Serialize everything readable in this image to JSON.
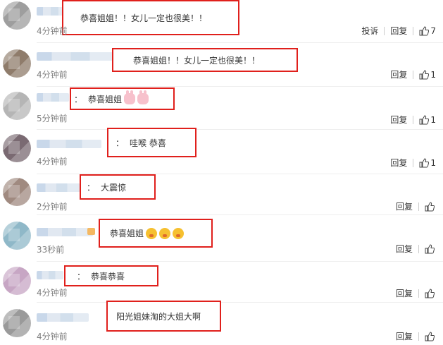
{
  "labels": {
    "report": "投诉",
    "reply": "回复",
    "colon": "："
  },
  "colors": {
    "highlight_border": "#e0201c",
    "username_blur": "#c9d8ea",
    "time_text": "#808080"
  },
  "comments": [
    {
      "text": "恭喜姐姐！！女儿一定也很美！！",
      "time": "4分钟前",
      "likes": "7",
      "show_report": true,
      "emojis": []
    },
    {
      "text": "恭喜姐姐！！女儿一定也很美！！",
      "time": "4分钟前",
      "likes": "1",
      "show_report": false,
      "emojis": []
    },
    {
      "text": "恭喜姐姐",
      "time": "5分钟前",
      "likes": "1",
      "show_report": false,
      "emojis": [
        "rabbit-emoji",
        "rabbit-emoji"
      ]
    },
    {
      "text": "哇喉 恭喜",
      "time": "4分钟前",
      "likes": "1",
      "show_report": false,
      "emojis": []
    },
    {
      "text": "大震惊",
      "time": "2分钟前",
      "likes": "",
      "show_report": false,
      "emojis": []
    },
    {
      "text": "恭喜姐姐",
      "time": "33秒前",
      "likes": "",
      "show_report": false,
      "emojis": [
        "blush-emoji",
        "blush-emoji",
        "blush-emoji"
      ]
    },
    {
      "text": "恭喜恭喜",
      "time": "4分钟前",
      "likes": "",
      "show_report": false,
      "emojis": []
    },
    {
      "text": "阳光姐妹淘的大姐大啊",
      "time": "4分钟前",
      "likes": "",
      "show_report": false,
      "emojis": []
    }
  ]
}
